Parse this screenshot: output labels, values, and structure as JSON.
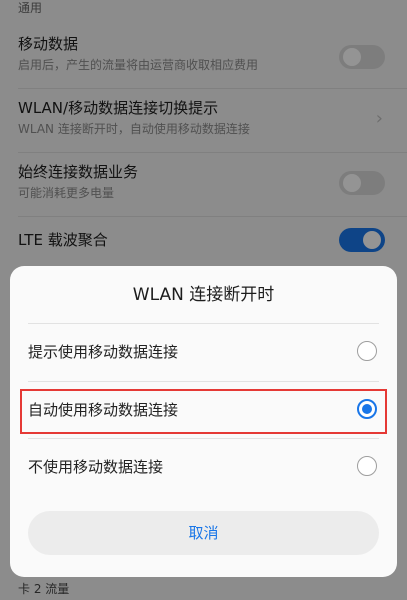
{
  "settings": {
    "section_header": "通用",
    "mobile_data": {
      "title": "移动数据",
      "subtitle": "启用后，产生的流量将由运营商收取相应费用",
      "enabled": false
    },
    "wlan_switch": {
      "title": "WLAN/移动数据连接切换提示",
      "subtitle": "WLAN 连接断开时，自动使用移动数据连接"
    },
    "always_on": {
      "title": "始终连接数据业务",
      "subtitle": "可能消耗更多电量",
      "enabled": false
    },
    "lte": {
      "title": "LTE 载波聚合",
      "enabled": true
    },
    "bottom_peek": "卡 2 流量"
  },
  "dialog": {
    "title": "WLAN 连接断开时",
    "options": [
      {
        "label": "提示使用移动数据连接",
        "selected": false
      },
      {
        "label": "自动使用移动数据连接",
        "selected": true
      },
      {
        "label": "不使用移动数据连接",
        "selected": false
      }
    ],
    "cancel_label": "取消"
  },
  "colors": {
    "accent": "#1976e8",
    "highlight_border": "#e53935",
    "toggle_off": "#d7d7d7"
  },
  "icons": {
    "chevron": "chevron-right-icon"
  }
}
